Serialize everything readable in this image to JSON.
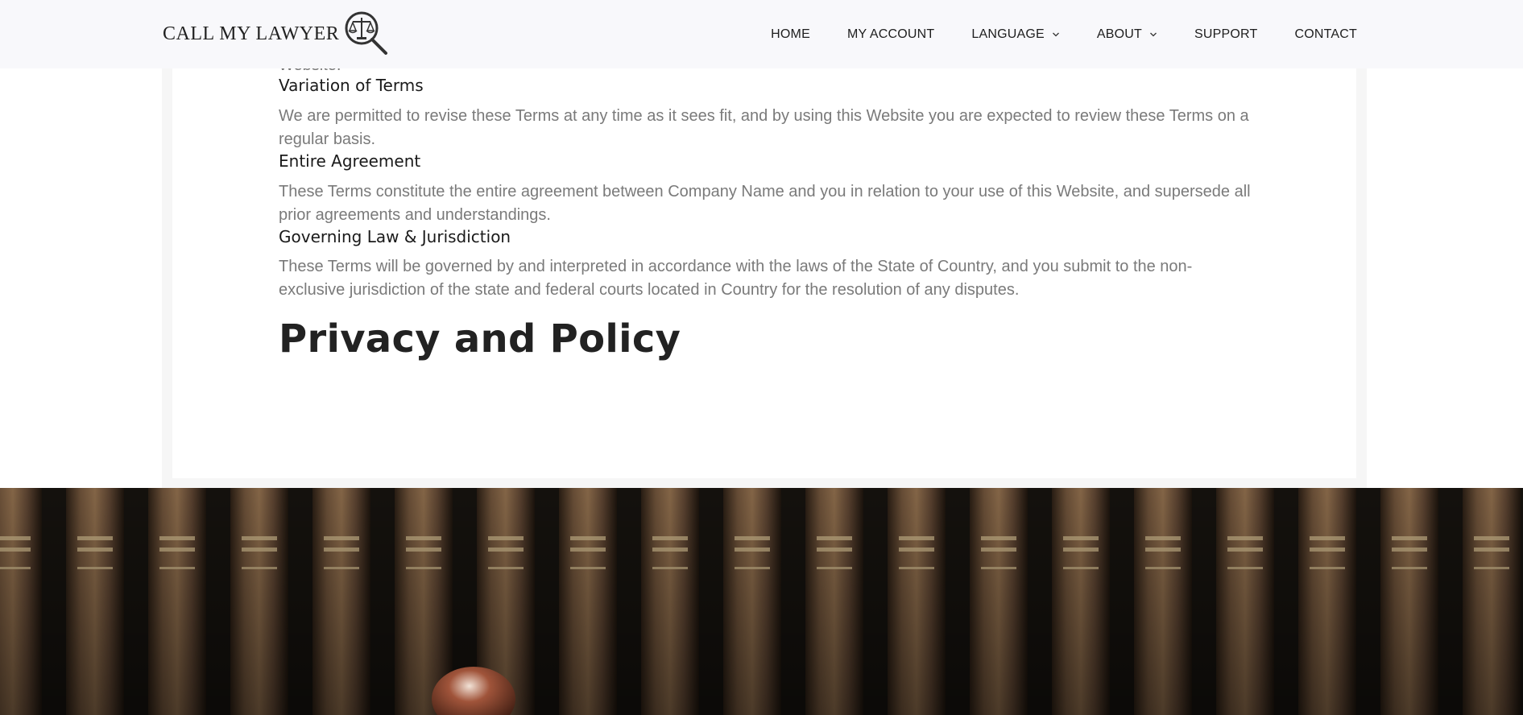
{
  "header": {
    "logo_text": "CALL MY LAWYER",
    "logo_icon": "scales-magnifier-icon",
    "nav": [
      {
        "label": "HOME",
        "has_dropdown": false
      },
      {
        "label": "MY ACCOUNT",
        "has_dropdown": false
      },
      {
        "label": "LANGUAGE",
        "has_dropdown": true
      },
      {
        "label": "ABOUT",
        "has_dropdown": true
      },
      {
        "label": "SUPPORT",
        "has_dropdown": false
      },
      {
        "label": "CONTACT",
        "has_dropdown": false
      }
    ]
  },
  "content": {
    "cut_off_text": "Website.",
    "sections": [
      {
        "title": "Variation of Terms",
        "body": "We are permitted to revise these Terms at any time as it sees fit, and by using this Website you are expected to review these Terms on a regular basis."
      },
      {
        "title": "Entire Agreement",
        "body": "These Terms constitute the entire agreement between Company Name and you in relation to your use of this Website, and supersede all prior agreements and understandings."
      },
      {
        "title": "Governing Law & Jurisdiction",
        "body": "These Terms will be governed by and interpreted in accordance with the laws of the State of Country, and you submit to the non-exclusive jurisdiction of the state and federal courts located in Country for the resolution of any disputes."
      }
    ],
    "privacy_title": "Privacy and Policy"
  },
  "colors": {
    "header_bg": "#f8f8fb",
    "body_text": "#7a7a7a",
    "heading_text": "#1a1a1a",
    "book_brown": "#5a4330"
  }
}
